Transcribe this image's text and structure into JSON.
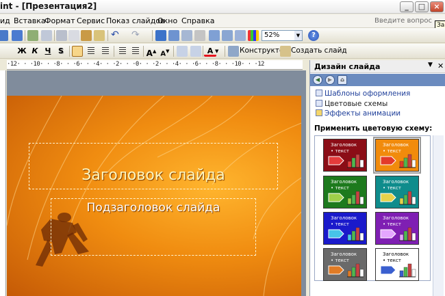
{
  "window": {
    "title": "int - [Презентация2]",
    "buttons": [
      "_",
      "□",
      "×"
    ]
  },
  "menu": {
    "items": [
      {
        "label": "ид"
      },
      {
        "label": "Вставка"
      },
      {
        "label": "Формат"
      },
      {
        "label": "Сервис"
      },
      {
        "label": "Показ слайдов"
      },
      {
        "label": "Окно"
      },
      {
        "label": "Справка"
      }
    ],
    "help_placeholder": "Введите вопрос",
    "tooltip": "Закрыть"
  },
  "toolbar": {
    "zoom": "52%",
    "bold": "Ж",
    "italic": "К",
    "underline": "Ч",
    "shadow": "S",
    "font_color": "А",
    "designer": "Конструктор",
    "new_slide": "Создать слайд"
  },
  "ruler": {
    "text": "·12· · ·10· · ·8· · ·6· · ·4· · ·2· · ·0· · ·2· · ·4· · ·6· · ·8· · ·10· · ·12"
  },
  "slide": {
    "title": "Заголовок слайда",
    "subtitle": "Подзаголовок слайда",
    "background_color": "#f08c10"
  },
  "taskpane": {
    "title": "Дизайн слайда",
    "links": [
      {
        "label": "Шаблоны оформления",
        "icon": "design-templates-icon"
      },
      {
        "label": "Цветовые схемы",
        "icon": "color-schemes-icon"
      },
      {
        "label": "Эффекты анимации",
        "icon": "animation-effects-icon"
      }
    ],
    "apply_label": "Применить цветовую схему:",
    "schemes": [
      {
        "title": "Заголовок",
        "text": "• текст",
        "bg": "#8b0d16",
        "fg": "#ffffff",
        "accent": "#e43b3b"
      },
      {
        "title": "Заголовок",
        "text": "• текст",
        "bg": "#f18b0c",
        "fg": "#ffffff",
        "accent": "#e33a2a"
      },
      {
        "title": "Заголовок",
        "text": "• текст",
        "bg": "#1d7a1d",
        "fg": "#ffffff",
        "accent": "#9fd04a"
      },
      {
        "title": "Заголовок",
        "text": "• текст",
        "bg": "#0f8c8c",
        "fg": "#ffffff",
        "accent": "#e4d24b"
      },
      {
        "title": "Заголовок",
        "text": "• текст",
        "bg": "#1a1acb",
        "fg": "#ffffff",
        "accent": "#47c3e8"
      },
      {
        "title": "Заголовок",
        "text": "• текст",
        "bg": "#7f1fb3",
        "fg": "#ffffff",
        "accent": "#e4a6ff"
      },
      {
        "title": "Заголовок",
        "text": "• текст",
        "bg": "#6a6a6a",
        "fg": "#ffffff",
        "accent": "#e07b25"
      },
      {
        "title": "Заголовок",
        "text": "• текст",
        "bg": "#ffffff",
        "fg": "#000000",
        "accent": "#3a5fcf"
      }
    ]
  }
}
